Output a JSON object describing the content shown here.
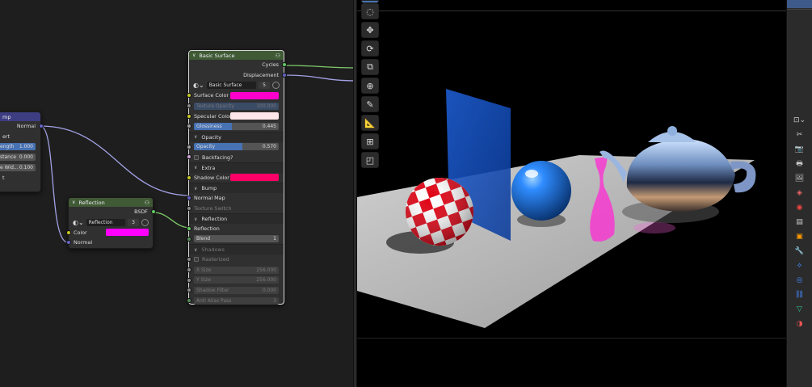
{
  "node_editor": {
    "left_node": {
      "title_fragment": "mp",
      "output": "Normal",
      "rows": [
        {
          "label": "ert",
          "value": ""
        },
        {
          "label": "ength",
          "value": "1.000"
        },
        {
          "label": "stance",
          "value": "0.000"
        },
        {
          "label": "e Wid...",
          "value": "0.100"
        },
        {
          "label": "t",
          "value": ""
        }
      ]
    },
    "reflection_node": {
      "title": "Reflection",
      "output": "BSDF",
      "datablock_name": "Reflection",
      "datablock_users": "3",
      "color_label": "Color",
      "color_value": "#ff00ff",
      "normal_label": "Normal"
    },
    "basic_surface_node": {
      "title": "Basic Surface",
      "outputs": [
        "Cycles",
        "Displacement"
      ],
      "datablock_name": "Basic Surface",
      "datablock_users": "5",
      "surface_color_label": "Surface Color",
      "surface_color_value": "#ff00cc",
      "texture_opacity_label": "Texture Opacity",
      "texture_opacity_value": "100.000",
      "specular_color_label": "Specular Color",
      "specular_color_value": "#ffe6ea",
      "glossiness_label": "Glossiness",
      "glossiness_value": "0.445",
      "opacity_panel": "Opacity",
      "opacity_label": "Opacity",
      "opacity_value": "0.570",
      "backfacing_label": "Backfacing?",
      "extra_panel": "Extra",
      "shadow_color_label": "Shadow Color",
      "shadow_color_value": "#ff0066",
      "bump_panel": "Bump",
      "normal_map_label": "Normal Map",
      "texture_switch_label": "Texture Switch",
      "reflection_panel": "Reflection",
      "reflection_label": "Reflection",
      "blend_label": "Blend",
      "blend_value": "1",
      "shadows_panel": "Shadows",
      "rasterized_label": "Rasterized",
      "xsize_label": "X Size",
      "xsize_value": "256.000",
      "ysize_label": "Y Size",
      "ysize_value": "256.000",
      "shadow_filter_label": "Shadow Filter",
      "shadow_filter_value": "0.000",
      "anti_alias_label": "Anti Alias Pass",
      "anti_alias_value": "3"
    }
  },
  "viewport": {
    "tools": [
      "select-circle-icon",
      "move-icon",
      "rotate-icon",
      "scale-icon",
      "transform-icon",
      "annotate-icon",
      "measure-icon",
      "add-cube-icon",
      "fillet-icon"
    ]
  },
  "properties_tabs": [
    "tool-icon",
    "render-icon",
    "output-icon",
    "view-layer-icon",
    "scene-icon",
    "world-icon",
    "object-icon",
    "modifier-icon",
    "particles-icon",
    "physics-icon",
    "constraints-icon",
    "data-icon",
    "material-icon"
  ]
}
